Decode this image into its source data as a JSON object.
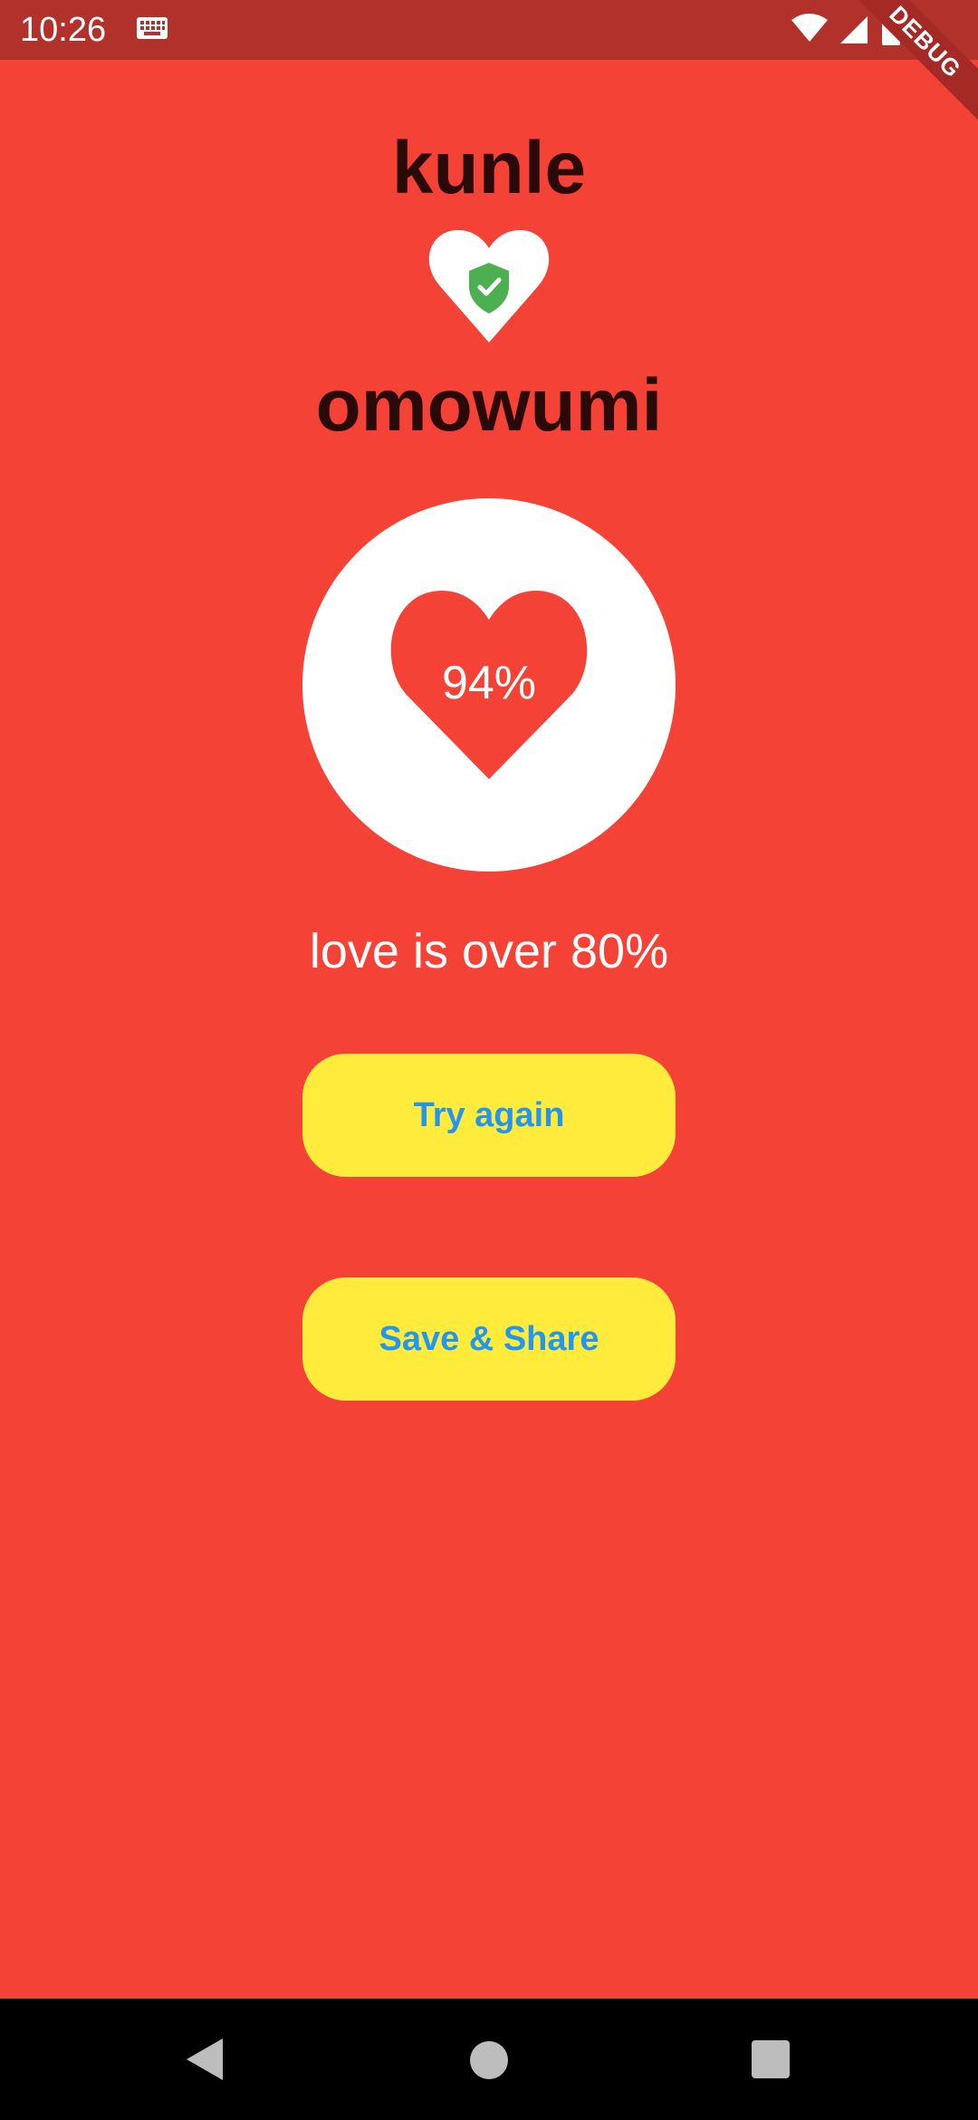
{
  "status_bar": {
    "time": "10:26",
    "icons": [
      "keyboard-icon",
      "wifi-icon",
      "signal-icon",
      "battery-icon"
    ],
    "debug_label": "DEBUG"
  },
  "names": {
    "first": "kunle",
    "second": "omowumi"
  },
  "result": {
    "percentage": "94%",
    "message": "love is over 80%"
  },
  "buttons": {
    "try_again": "Try again",
    "save_share": "Save & Share"
  },
  "colors": {
    "background": "#F44336",
    "status_bar": "#B3312B",
    "button_bg": "#FFEB3B",
    "button_text": "#2196F3",
    "shield": "#4CAF50",
    "name_text": "#2A0A08"
  },
  "nav_bar": {
    "icons": [
      "back-icon",
      "home-icon",
      "recent-apps-icon"
    ]
  }
}
